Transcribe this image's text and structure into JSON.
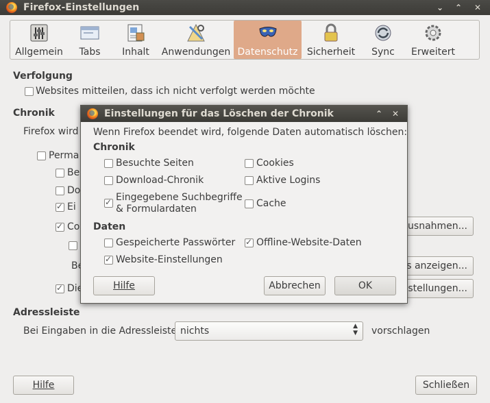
{
  "window": {
    "title": "Firefox-Einstellungen"
  },
  "toolbar": {
    "tabs": [
      {
        "label": "Allgemein",
        "icon": "sliders-icon"
      },
      {
        "label": "Tabs",
        "icon": "tabs-icon"
      },
      {
        "label": "Inhalt",
        "icon": "content-icon"
      },
      {
        "label": "Anwendungen",
        "icon": "applications-icon"
      },
      {
        "label": "Datenschutz",
        "icon": "mask-icon",
        "selected": true
      },
      {
        "label": "Sicherheit",
        "icon": "lock-icon"
      },
      {
        "label": "Sync",
        "icon": "sync-icon"
      },
      {
        "label": "Erweitert",
        "icon": "gear-icon"
      }
    ]
  },
  "tracking": {
    "heading": "Verfolgung",
    "option": "Websites mitteilen, dass ich nicht verfolgt werden möchte"
  },
  "history": {
    "heading": "Chronik",
    "firefox_will": "Firefox wird",
    "perm_prefix": "Perma",
    "row_be": "Be",
    "row_do": "Do",
    "row_ei": "Ei",
    "row_co": "Co",
    "row_be2": "Be",
    "row_die": "Die",
    "btn_exceptions": "Ausnahmen...",
    "btn_show": "es anzeigen...",
    "btn_settings": "nstellungen..."
  },
  "addressbar": {
    "heading": "Adressleiste",
    "label": "Bei Eingaben in die Adressleiste",
    "select_value": "nichts",
    "suffix": "vorschlagen"
  },
  "footer": {
    "help": "Hilfe",
    "close": "Schließen"
  },
  "dialog": {
    "title": "Einstellungen für das Löschen der Chronik",
    "intro": "Wenn Firefox beendet wird, folgende Daten automatisch löschen:",
    "history_heading": "Chronik",
    "visited": "Besuchte Seiten",
    "downloads": "Download-Chronik",
    "search_line1": "Eingegebene Suchbegriffe",
    "search_line2": "& Formulardaten",
    "cookies": "Cookies",
    "logins": "Aktive Logins",
    "cache": "Cache",
    "data_heading": "Daten",
    "passwords": "Gespeicherte Passwörter",
    "site_settings": "Website-Einstellungen",
    "offline": "Offline-Website-Daten",
    "help": "Hilfe",
    "cancel": "Abbrechen",
    "ok": "OK"
  }
}
